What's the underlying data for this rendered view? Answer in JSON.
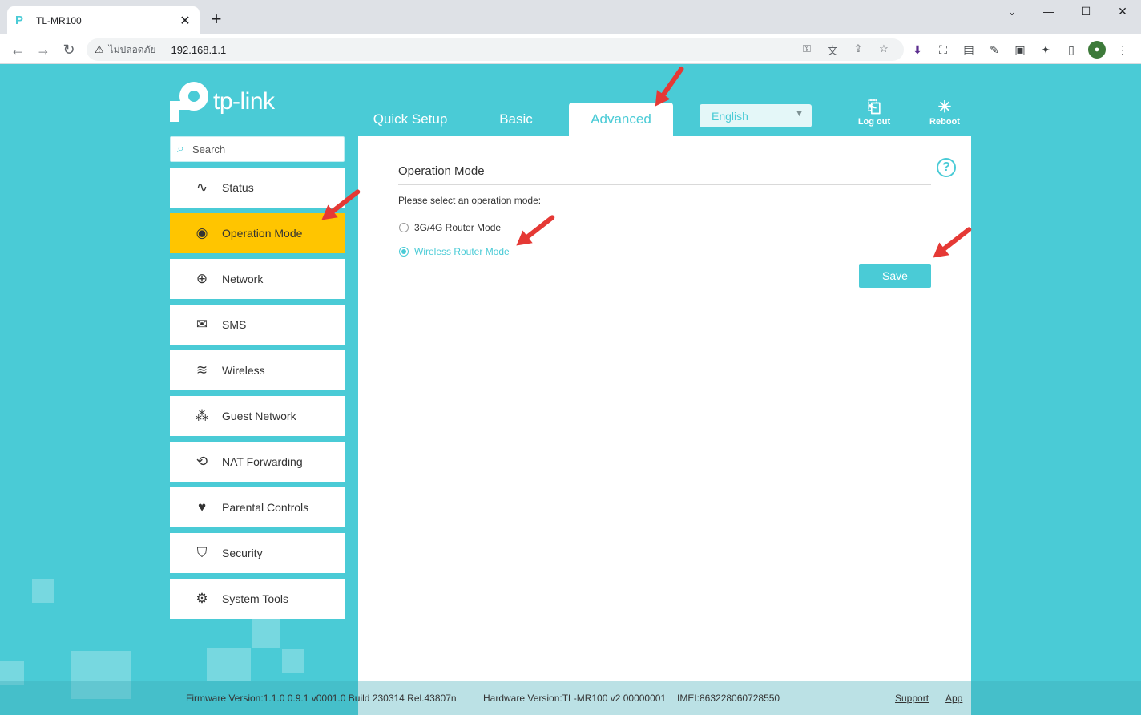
{
  "browser": {
    "tab_title": "TL-MR100",
    "security_label": "ไม่ปลอดภัย",
    "url": "192.168.1.1"
  },
  "header": {
    "logo_text": "tp-link",
    "nav": [
      "Quick Setup",
      "Basic",
      "Advanced"
    ],
    "active_nav": "Advanced",
    "language": "English",
    "logout_label": "Log out",
    "reboot_label": "Reboot"
  },
  "sidebar": {
    "search_placeholder": "Search",
    "items": [
      {
        "label": "Status",
        "icon": "pulse-icon"
      },
      {
        "label": "Operation Mode",
        "icon": "toggle-icon",
        "active": true
      },
      {
        "label": "Network",
        "icon": "globe-icon"
      },
      {
        "label": "SMS",
        "icon": "envelope-icon"
      },
      {
        "label": "Wireless",
        "icon": "wifi-icon"
      },
      {
        "label": "Guest Network",
        "icon": "guests-icon"
      },
      {
        "label": "NAT Forwarding",
        "icon": "nat-icon"
      },
      {
        "label": "Parental Controls",
        "icon": "heart-icon"
      },
      {
        "label": "Security",
        "icon": "shield-icon"
      },
      {
        "label": "System Tools",
        "icon": "gear-icon"
      }
    ]
  },
  "content": {
    "section_title": "Operation Mode",
    "prompt": "Please select an operation mode:",
    "options": [
      {
        "label": "3G/4G Router Mode",
        "selected": false
      },
      {
        "label": "Wireless Router Mode",
        "selected": true
      }
    ],
    "save_label": "Save"
  },
  "footer": {
    "firmware": "Firmware Version:1.1.0 0.9.1 v0001.0 Build 230314 Rel.43807n",
    "hardware": "Hardware Version:TL-MR100 v2 00000001",
    "imei": "IMEI:863228060728550",
    "support": "Support",
    "app": "App"
  },
  "colors": {
    "brand": "#4acbd6",
    "active_item": "#ffc500",
    "annotation": "#e53935"
  }
}
